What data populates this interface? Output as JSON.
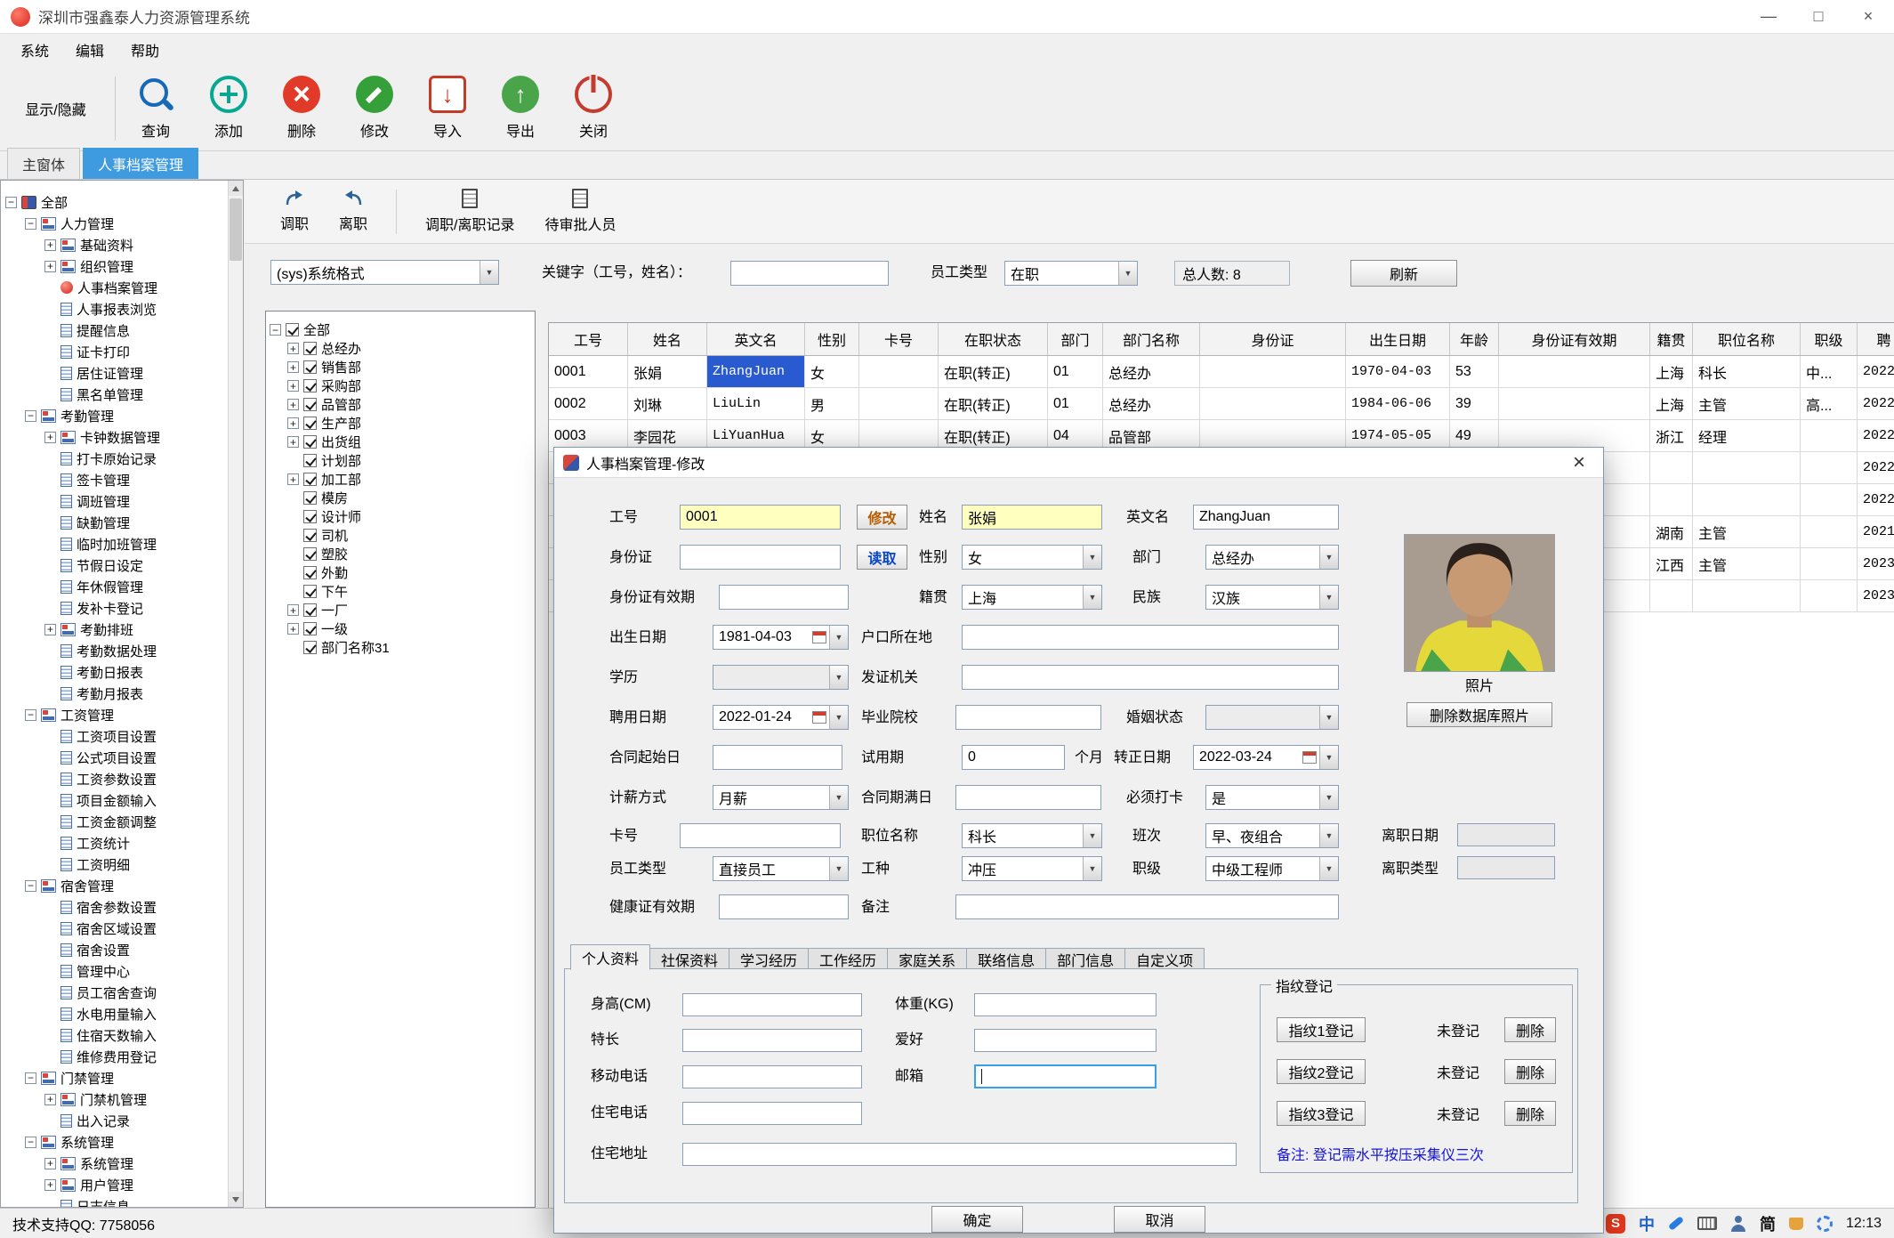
{
  "window": {
    "title": "深圳市强鑫泰人力资源管理系统",
    "minimize": "—",
    "maximize": "□",
    "close": "×"
  },
  "menu": [
    "系统",
    "编辑",
    "帮助"
  ],
  "toolbar": {
    "toggle": "显示/隐藏",
    "buttons": [
      "查询",
      "添加",
      "删除",
      "修改",
      "导入",
      "导出",
      "关闭"
    ]
  },
  "main_tabs": [
    "主窗体",
    "人事档案管理"
  ],
  "nav_tree": [
    {
      "t": "全部",
      "lv": "lv0",
      "exp": "−",
      "ic": "i-root"
    },
    {
      "t": "人力管理",
      "lv": "lv1",
      "exp": "−",
      "ic": "i-grp"
    },
    {
      "t": "基础资料",
      "lv": "lv2",
      "exp": "+",
      "ic": "i-grp"
    },
    {
      "t": "组织管理",
      "lv": "lv2",
      "exp": "+",
      "ic": "i-grp"
    },
    {
      "t": "人事档案管理",
      "lv": "lv2",
      "exp": "",
      "ic": "i-act"
    },
    {
      "t": "人事报表浏览",
      "lv": "lv2",
      "exp": "",
      "ic": "i-doc"
    },
    {
      "t": "提醒信息",
      "lv": "lv2",
      "exp": "",
      "ic": "i-doc"
    },
    {
      "t": "证卡打印",
      "lv": "lv2",
      "exp": "",
      "ic": "i-doc"
    },
    {
      "t": "居住证管理",
      "lv": "lv2",
      "exp": "",
      "ic": "i-doc"
    },
    {
      "t": "黑名单管理",
      "lv": "lv2",
      "exp": "",
      "ic": "i-doc"
    },
    {
      "t": "考勤管理",
      "lv": "lv1",
      "exp": "−",
      "ic": "i-grp"
    },
    {
      "t": "卡钟数据管理",
      "lv": "lv2",
      "exp": "+",
      "ic": "i-grp"
    },
    {
      "t": "打卡原始记录",
      "lv": "lv2",
      "exp": "",
      "ic": "i-doc"
    },
    {
      "t": "签卡管理",
      "lv": "lv2",
      "exp": "",
      "ic": "i-doc"
    },
    {
      "t": "调班管理",
      "lv": "lv2",
      "exp": "",
      "ic": "i-doc"
    },
    {
      "t": "缺勤管理",
      "lv": "lv2",
      "exp": "",
      "ic": "i-doc"
    },
    {
      "t": "临时加班管理",
      "lv": "lv2",
      "exp": "",
      "ic": "i-doc"
    },
    {
      "t": "节假日设定",
      "lv": "lv2",
      "exp": "",
      "ic": "i-doc"
    },
    {
      "t": "年休假管理",
      "lv": "lv2",
      "exp": "",
      "ic": "i-doc"
    },
    {
      "t": "发补卡登记",
      "lv": "lv2",
      "exp": "",
      "ic": "i-doc"
    },
    {
      "t": "考勤排班",
      "lv": "lv2",
      "exp": "+",
      "ic": "i-grp"
    },
    {
      "t": "考勤数据处理",
      "lv": "lv2",
      "exp": "",
      "ic": "i-doc"
    },
    {
      "t": "考勤日报表",
      "lv": "lv2",
      "exp": "",
      "ic": "i-doc"
    },
    {
      "t": "考勤月报表",
      "lv": "lv2",
      "exp": "",
      "ic": "i-doc"
    },
    {
      "t": "工资管理",
      "lv": "lv1",
      "exp": "−",
      "ic": "i-grp"
    },
    {
      "t": "工资项目设置",
      "lv": "lv2",
      "exp": "",
      "ic": "i-doc"
    },
    {
      "t": "公式项目设置",
      "lv": "lv2",
      "exp": "",
      "ic": "i-doc"
    },
    {
      "t": "工资参数设置",
      "lv": "lv2",
      "exp": "",
      "ic": "i-doc"
    },
    {
      "t": "项目金额输入",
      "lv": "lv2",
      "exp": "",
      "ic": "i-doc"
    },
    {
      "t": "工资金额调整",
      "lv": "lv2",
      "exp": "",
      "ic": "i-doc"
    },
    {
      "t": "工资统计",
      "lv": "lv2",
      "exp": "",
      "ic": "i-doc"
    },
    {
      "t": "工资明细",
      "lv": "lv2",
      "exp": "",
      "ic": "i-doc"
    },
    {
      "t": "宿舍管理",
      "lv": "lv1",
      "exp": "−",
      "ic": "i-grp"
    },
    {
      "t": "宿舍参数设置",
      "lv": "lv2",
      "exp": "",
      "ic": "i-doc"
    },
    {
      "t": "宿舍区域设置",
      "lv": "lv2",
      "exp": "",
      "ic": "i-doc"
    },
    {
      "t": "宿舍设置",
      "lv": "lv2",
      "exp": "",
      "ic": "i-doc"
    },
    {
      "t": "管理中心",
      "lv": "lv2",
      "exp": "",
      "ic": "i-doc"
    },
    {
      "t": "员工宿舍查询",
      "lv": "lv2",
      "exp": "",
      "ic": "i-doc"
    },
    {
      "t": "水电用量输入",
      "lv": "lv2",
      "exp": "",
      "ic": "i-doc"
    },
    {
      "t": "住宿天数输入",
      "lv": "lv2",
      "exp": "",
      "ic": "i-doc"
    },
    {
      "t": "维修费用登记",
      "lv": "lv2",
      "exp": "",
      "ic": "i-doc"
    },
    {
      "t": "门禁管理",
      "lv": "lv1",
      "exp": "−",
      "ic": "i-grp"
    },
    {
      "t": "门禁机管理",
      "lv": "lv2",
      "exp": "+",
      "ic": "i-grp"
    },
    {
      "t": "出入记录",
      "lv": "lv2",
      "exp": "",
      "ic": "i-doc"
    },
    {
      "t": "系统管理",
      "lv": "lv1",
      "exp": "−",
      "ic": "i-grp"
    },
    {
      "t": "系统管理",
      "lv": "lv2",
      "exp": "+",
      "ic": "i-grp"
    },
    {
      "t": "用户管理",
      "lv": "lv2",
      "exp": "+",
      "ic": "i-grp"
    },
    {
      "t": "日志信息",
      "lv": "lv2",
      "exp": "",
      "ic": "i-doc"
    }
  ],
  "sub_toolbar": [
    "调职",
    "离职",
    "调职/离职记录",
    "待审批人员"
  ],
  "filter": {
    "format": "(sys)系统格式",
    "keyword_label": "关键字（工号，姓名）：",
    "type_label": "员工类型",
    "type_value": "在职",
    "total": "总人数: 8",
    "refresh": "刷新"
  },
  "dept_tree": [
    {
      "t": "全部",
      "lv": "lv0",
      "exp": "−"
    },
    {
      "t": "总经办",
      "lv": "lv1",
      "exp": "+"
    },
    {
      "t": "销售部",
      "lv": "lv1",
      "exp": "+"
    },
    {
      "t": "采购部",
      "lv": "lv1",
      "exp": "+"
    },
    {
      "t": "品管部",
      "lv": "lv1",
      "exp": "+"
    },
    {
      "t": "生产部",
      "lv": "lv1",
      "exp": "+"
    },
    {
      "t": "出货组",
      "lv": "lv1",
      "exp": "+"
    },
    {
      "t": "计划部",
      "lv": "lv1",
      "exp": ""
    },
    {
      "t": "加工部",
      "lv": "lv1",
      "exp": "+"
    },
    {
      "t": "模房",
      "lv": "lv1",
      "exp": ""
    },
    {
      "t": "设计师",
      "lv": "lv1",
      "exp": ""
    },
    {
      "t": "司机",
      "lv": "lv1",
      "exp": ""
    },
    {
      "t": "塑胶",
      "lv": "lv1",
      "exp": ""
    },
    {
      "t": "外勤",
      "lv": "lv1",
      "exp": ""
    },
    {
      "t": "下午",
      "lv": "lv1",
      "exp": ""
    },
    {
      "t": "一厂",
      "lv": "lv1",
      "exp": "+"
    },
    {
      "t": "一级",
      "lv": "lv1",
      "exp": "+"
    },
    {
      "t": "部门名称31",
      "lv": "lv1",
      "exp": ""
    }
  ],
  "table": {
    "columns": [
      {
        "t": "工号",
        "w": "c0"
      },
      {
        "t": "姓名",
        "w": "c1"
      },
      {
        "t": "英文名",
        "w": "c2"
      },
      {
        "t": "性别",
        "w": "c3"
      },
      {
        "t": "卡号",
        "w": "c4"
      },
      {
        "t": "在职状态",
        "w": "c5"
      },
      {
        "t": "部门",
        "w": "c6"
      },
      {
        "t": "部门名称",
        "w": "c7"
      },
      {
        "t": "身份证",
        "w": "c8"
      },
      {
        "t": "出生日期",
        "w": "c9"
      },
      {
        "t": "年龄",
        "w": "c10"
      },
      {
        "t": "身份证有效期",
        "w": "c11"
      },
      {
        "t": "籍贯",
        "w": "c12"
      },
      {
        "t": "职位名称",
        "w": "c13"
      },
      {
        "t": "职级",
        "w": "c14"
      },
      {
        "t": "聘",
        "w": "c15"
      }
    ],
    "rows": [
      {
        "c": [
          "0001",
          "张娟",
          "ZhangJuan",
          "女",
          "",
          "在职(转正)",
          "01",
          "总经办",
          "",
          "1970-04-03",
          "53",
          "",
          "上海",
          "科长",
          "中...",
          "2022"
        ],
        "sel2": "cell-sel"
      },
      {
        "c": [
          "0002",
          "刘琳",
          "LiuLin",
          "男",
          "",
          "在职(转正)",
          "01",
          "总经办",
          "",
          "1984-06-06",
          "39",
          "",
          "上海",
          "主管",
          "高...",
          "2022"
        ]
      },
      {
        "c": [
          "0003",
          "李园花",
          "LiYuanHua",
          "女",
          "",
          "在职(转正)",
          "04",
          "品管部",
          "",
          "1974-05-05",
          "49",
          "",
          "浙江",
          "经理",
          "",
          "2022"
        ]
      },
      {
        "c": [
          "",
          "",
          "",
          "",
          "",
          "",
          "",
          "",
          "",
          "",
          "",
          "",
          "",
          "",
          "",
          "2022"
        ]
      },
      {
        "c": [
          "",
          "",
          "",
          "",
          "",
          "",
          "",
          "",
          "",
          "",
          "",
          "",
          "",
          "",
          "",
          "2022"
        ]
      },
      {
        "c": [
          "",
          "",
          "",
          "",
          "",
          "",
          "",
          "",
          "",
          "",
          "",
          "",
          "湖南",
          "主管",
          "",
          "2021"
        ]
      },
      {
        "c": [
          "",
          "",
          "",
          "",
          "",
          "",
          "",
          "",
          "",
          "",
          "",
          "",
          "江西",
          "主管",
          "",
          "2023"
        ]
      },
      {
        "c": [
          "",
          "",
          "",
          "",
          "",
          "",
          "",
          "",
          "",
          "",
          "",
          "",
          "",
          "",
          "",
          "2023"
        ]
      }
    ]
  },
  "dialog": {
    "title": "人事档案管理-修改",
    "close": "×",
    "modify_btn": "修改",
    "read_btn": "读取",
    "fields": {
      "emp_no": {
        "label": "工号",
        "value": "0001"
      },
      "name": {
        "label": "姓名",
        "value": "张娟"
      },
      "en_name": {
        "label": "英文名",
        "value": "ZhangJuan"
      },
      "id_card": {
        "label": "身份证",
        "value": ""
      },
      "gender": {
        "label": "性别",
        "value": "女"
      },
      "dept": {
        "label": "部门",
        "value": "总经办"
      },
      "id_valid": {
        "label": "身份证有效期",
        "value": ""
      },
      "native_place": {
        "label": "籍贯",
        "value": "上海"
      },
      "ethnic": {
        "label": "民族",
        "value": "汉族"
      },
      "birth_date": {
        "label": "出生日期",
        "value": "1981-04-03"
      },
      "residence": {
        "label": "户口所在地",
        "value": ""
      },
      "education": {
        "label": "学历",
        "value": ""
      },
      "issuer": {
        "label": "发证机关",
        "value": ""
      },
      "hire_date": {
        "label": "聘用日期",
        "value": "2022-01-24"
      },
      "school": {
        "label": "毕业院校",
        "value": ""
      },
      "marital": {
        "label": "婚姻状态",
        "value": ""
      },
      "contract_start": {
        "label": "合同起始日",
        "value": ""
      },
      "probation": {
        "label": "试用期",
        "value": "0",
        "suffix": "个月"
      },
      "regular_date": {
        "label": "转正日期",
        "value": "2022-03-24"
      },
      "pay_type": {
        "label": "计薪方式",
        "value": "月薪"
      },
      "contract_end": {
        "label": "合同期满日",
        "value": ""
      },
      "must_punch": {
        "label": "必须打卡",
        "value": "是"
      },
      "card_no": {
        "label": "卡号",
        "value": ""
      },
      "position": {
        "label": "职位名称",
        "value": "科长"
      },
      "shift": {
        "label": "班次",
        "value": "早、夜组合"
      },
      "emp_type": {
        "label": "员工类型",
        "value": "直接员工"
      },
      "work_type": {
        "label": "工种",
        "value": "冲压"
      },
      "rank": {
        "label": "职级",
        "value": "中级工程师"
      },
      "health_valid": {
        "label": "健康证有效期",
        "value": ""
      },
      "remark": {
        "label": "备注",
        "value": ""
      },
      "leave_date": {
        "label": "离职日期",
        "value": ""
      },
      "leave_type": {
        "label": "离职类型",
        "value": ""
      }
    },
    "photo_label": "照片",
    "photo_delete_btn": "删除数据库照片",
    "tabs": [
      {
        "t": "个人资料",
        "cls": "tab-active"
      },
      {
        "t": "社保资料"
      },
      {
        "t": "学习经历"
      },
      {
        "t": "工作经历"
      },
      {
        "t": "家庭关系"
      },
      {
        "t": "联络信息"
      },
      {
        "t": "部门信息"
      },
      {
        "t": "自定义项"
      }
    ],
    "personal": {
      "height_label": "身高(CM)",
      "weight_label": "体重(KG)",
      "specialty_label": "特长",
      "hobby_label": "爱好",
      "mobile_label": "移动电话",
      "email_label": "邮箱",
      "home_phone_label": "住宅电话",
      "home_address_label": "住宅地址"
    },
    "fingerprint": {
      "title": "指纹登记",
      "rows": [
        {
          "btn": "指纹1登记",
          "status": "未登记",
          "del": "删除"
        },
        {
          "btn": "指纹2登记",
          "status": "未登记",
          "del": "删除"
        },
        {
          "btn": "指纹3登记",
          "status": "未登记",
          "del": "删除"
        }
      ],
      "note": "备注: 登记需水平按压采集仪三次"
    },
    "ok": "确定",
    "cancel": "取消"
  },
  "statusbar": {
    "support": "技术支持QQ: 7758056",
    "tray_zhong": "中",
    "tray_jian": "简",
    "time": "12:13"
  }
}
